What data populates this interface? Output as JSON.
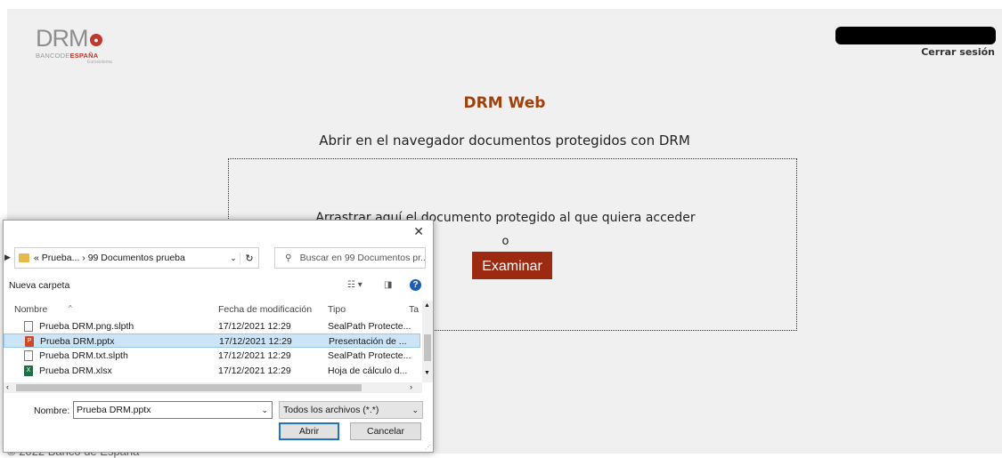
{
  "header": {
    "logo_main": "DRM",
    "logo_sub_prefix": "BANCODE",
    "logo_sub_brand": "ESPAÑA",
    "logo_sub2": "Eurosistema",
    "logout_label": "Cerrar sesión"
  },
  "main": {
    "title": "DRM Web",
    "subtitle": "Abrir en el navegador documentos protegidos con DRM",
    "drop_text": "Arrastrar aquí el documento protegido al que quiera acceder",
    "or_text": "o",
    "browse_label": "Examinar",
    "footer": "© 2022 Banco de España"
  },
  "colors": {
    "title": "#a0410d",
    "browse_button": "#9b2a10",
    "selected_row": "#cce4f7"
  },
  "dialog": {
    "path": "« Prueba...  ›  99 Documentos prueba",
    "search_placeholder": "Buscar en 99 Documentos pr...",
    "new_folder": "Nueva carpeta",
    "columns": {
      "name": "Nombre",
      "date": "Fecha de modificación",
      "type": "Tipo",
      "size": "Ta"
    },
    "files": [
      {
        "name": "Prueba DRM.png.slpth",
        "date": "17/12/2021 12:29",
        "type": "SealPath Protecte...",
        "icon": "document-icon"
      },
      {
        "name": "Prueba DRM.pptx",
        "date": "17/12/2021 12:29",
        "type": "Presentación de ...",
        "icon": "powerpoint-icon"
      },
      {
        "name": "Prueba DRM.txt.slpth",
        "date": "17/12/2021 12:29",
        "type": "SealPath Protecte...",
        "icon": "document-icon"
      },
      {
        "name": "Prueba DRM.xlsx",
        "date": "17/12/2021 12:29",
        "type": "Hoja de cálculo d...",
        "icon": "excel-icon"
      }
    ],
    "filename_label": "Nombre:",
    "filename_value": "Prueba DRM.pptx",
    "filter_value": "Todos los archivos (*.*)",
    "open_label": "Abrir",
    "cancel_label": "Cancelar"
  }
}
